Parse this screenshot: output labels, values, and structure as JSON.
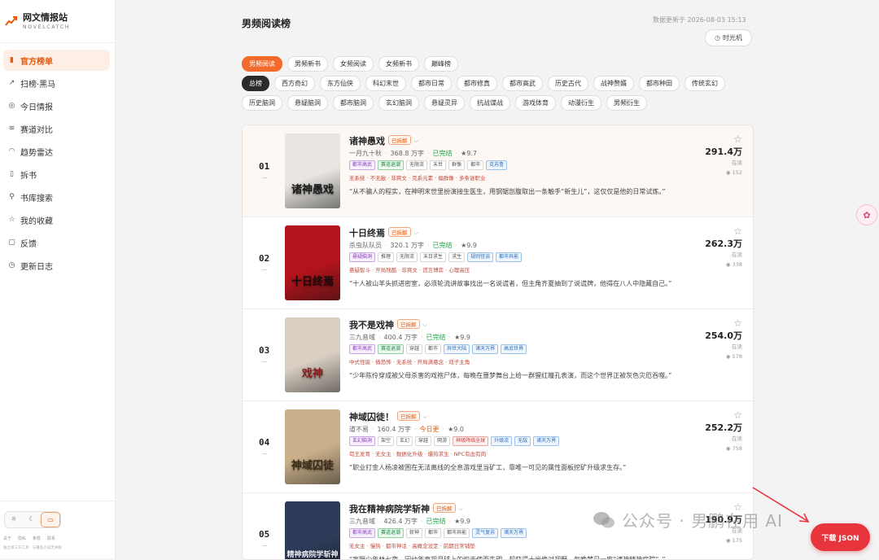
{
  "brand": {
    "title": "网文情报站",
    "subtitle": "NOVELCATCH"
  },
  "nav": [
    {
      "label": "官方榜单",
      "icon": "bar-chart-icon",
      "active": true
    },
    {
      "label": "扫榜·黑马",
      "icon": "trend-up-icon",
      "active": false
    },
    {
      "label": "今日情报",
      "icon": "target-icon",
      "active": false
    },
    {
      "label": "赛道对比",
      "icon": "layers-icon",
      "active": false
    },
    {
      "label": "趋势雷达",
      "icon": "radar-icon",
      "active": false
    },
    {
      "label": "拆书",
      "icon": "book-icon",
      "active": false
    },
    {
      "label": "书库搜索",
      "icon": "search-icon",
      "active": false
    },
    {
      "label": "我的收藏",
      "icon": "star-icon",
      "active": false
    },
    {
      "label": "反馈",
      "icon": "chat-icon",
      "active": false
    },
    {
      "label": "更新日志",
      "icon": "clock-icon",
      "active": false
    }
  ],
  "sidebar_footer": {
    "links": [
      "关于",
      "隐私",
      "条款",
      "联系"
    ],
    "note": "独立第三方工具 · 与番茄小说无关联"
  },
  "header": {
    "title": "男频阅读榜",
    "updated": "数据更新于 2026-08-03 15:13",
    "time_machine": "时光机"
  },
  "rank_types": [
    "男频阅读",
    "男频新书",
    "女频阅读",
    "女频新书",
    "巅峰榜"
  ],
  "rank_type_active": 0,
  "categories_row1": [
    "总榜",
    "西方奇幻",
    "东方仙侠",
    "科幻末世",
    "都市日常",
    "都市修真",
    "都市高武",
    "历史古代",
    "战神赘婿",
    "都市种田",
    "传统玄幻"
  ],
  "categories_row2": [
    "历史脑洞",
    "悬疑脑洞",
    "都市脑洞",
    "玄幻脑洞",
    "悬疑灵异",
    "抗战谍战",
    "游戏体育",
    "动漫衍生",
    "男频衍生"
  ],
  "category_active": 0,
  "split_label": "已拆解",
  "readers_label": "在读",
  "books": [
    {
      "rank": "01",
      "title": "诸神愚戏",
      "author": "一月九十秋",
      "words": "368.8 万字",
      "status": "已完结",
      "score": "★9.7",
      "tags": [
        {
          "t": "都市高武",
          "c": "purple"
        },
        {
          "t": "赛道退潮",
          "c": "green"
        },
        {
          "t": "无限流",
          "c": ""
        },
        {
          "t": "末世",
          "c": ""
        },
        {
          "t": "群像",
          "c": ""
        },
        {
          "t": "都市",
          "c": ""
        },
        {
          "t": "克苏鲁",
          "c": "blue"
        }
      ],
      "subtags": "无系统 · 不无敌 · 非爽文 · 克系元素 · 偏群像 · 多条谜职业",
      "desc": "“从不骗人的程实，在神明末世里扮演接生医生，用钢锯剖腹取出一条触手“新生儿”，这仅仅是他的日常试炼。”",
      "readers": "291.4万",
      "favs": "152",
      "cover": {
        "bg": "#e9e6e2",
        "fg": "#1a1a1a",
        "title": "诸神愚戏"
      }
    },
    {
      "rank": "02",
      "title": "十日终焉",
      "author": "杀虫队队员",
      "words": "320.1 万字",
      "status": "已完结",
      "score": "★9.9",
      "tags": [
        {
          "t": "悬疑脑洞",
          "c": "purple"
        },
        {
          "t": "推理",
          "c": ""
        },
        {
          "t": "无限流",
          "c": ""
        },
        {
          "t": "末日求生",
          "c": ""
        },
        {
          "t": "求生",
          "c": ""
        },
        {
          "t": "规则怪谈",
          "c": "blue"
        },
        {
          "t": "都市异能",
          "c": "blue"
        }
      ],
      "subtags": "悬疑智斗 · 开局残酷 · 非爽文 · 谎言博弈 · 心理高压",
      "desc": "“十人被山羊头抓进密室，必须轮流讲故事找出一名说谎者，但主角齐夏抽到了说谎牌，他得在八人中隐藏自己。”",
      "readers": "262.3万",
      "favs": "338",
      "cover": {
        "bg": "#b3141b",
        "fg": "#1a0a0a",
        "title": "十日终焉"
      }
    },
    {
      "rank": "03",
      "title": "我不是戏神",
      "author": "三九音域",
      "words": "400.4 万字",
      "status": "已完结",
      "score": "★9.9",
      "tags": [
        {
          "t": "都市高武",
          "c": "purple"
        },
        {
          "t": "赛道退潮",
          "c": "green"
        },
        {
          "t": "穿越",
          "c": ""
        },
        {
          "t": "都市",
          "c": ""
        },
        {
          "t": "异世大陆",
          "c": "blue"
        },
        {
          "t": "诸天万界",
          "c": "blue"
        },
        {
          "t": "高武世界",
          "c": "blue"
        }
      ],
      "subtags": "中式怪诞 · 微恐怖 · 无系统 · 开局满悬念 · 戏子主角",
      "desc": "“少年陈伶穿成被父母杀害的戏袍尸体，每晚在噩梦舞台上给一群猩红瞳孔表演，而这个世界正被灰色灾厄吞噬。”",
      "readers": "254.0万",
      "favs": "578",
      "cover": {
        "bg": "#d9cfc3",
        "fg": "#8a1c1c",
        "title": "戏神"
      }
    },
    {
      "rank": "04",
      "title": "神域囚徒！",
      "author": "道不易",
      "words": "160.4 万字",
      "status": "今日更",
      "score": "★9.0",
      "tags": [
        {
          "t": "玄幻脑洞",
          "c": "purple"
        },
        {
          "t": "架空",
          "c": ""
        },
        {
          "t": "玄幻",
          "c": ""
        },
        {
          "t": "穿越",
          "c": ""
        },
        {
          "t": "网游",
          "c": ""
        },
        {
          "t": "神级降临全球",
          "c": "red"
        },
        {
          "t": "升级流",
          "c": "blue"
        },
        {
          "t": "无敌",
          "c": "blue"
        },
        {
          "t": "诸天万界",
          "c": "blue"
        }
      ],
      "subtags": "苟王发育 · 无女主 · 数据化升级 · 爆热求生 · NPC有血有肉",
      "desc": "“职业打金人杨凌被困在无法离线的全息游戏里当矿工，靠唯一可见的属性面板挖矿升级求生存。”",
      "readers": "252.2万",
      "favs": "758",
      "cover": {
        "bg": "#c9b08a",
        "fg": "#3b2a14",
        "title": "神域囚徒"
      }
    },
    {
      "rank": "05",
      "title": "我在精神病院学斩神",
      "author": "三九音域",
      "words": "426.4 万字",
      "status": "已完结",
      "score": "★9.9",
      "tags": [
        {
          "t": "都市高武",
          "c": "purple"
        },
        {
          "t": "赛道退潮",
          "c": "green"
        },
        {
          "t": "斩神",
          "c": ""
        },
        {
          "t": "都市",
          "c": ""
        },
        {
          "t": "都市异能",
          "c": ""
        },
        {
          "t": "灵气复苏",
          "c": "blue"
        },
        {
          "t": "诸天万界",
          "c": "blue"
        }
      ],
      "subtags": "无女主 · 慢热 · 都市神话 · 高概念设定 · 前期日常铺垫",
      "desc": "“盲眼少年林七夜，因幼年直视月球上的炽天使而失明，却获得十米绝对视野，每晚梦见一座“诸神精神病院”。”",
      "readers": "190.9万",
      "favs": "175",
      "cover": {
        "bg": "#2c3b58",
        "fg": "#e8ecf5",
        "title": "精神病院学斩神"
      }
    }
  ],
  "watermark": "公众号 · 男鹏在用 AI",
  "download_button": "下载 JSON"
}
